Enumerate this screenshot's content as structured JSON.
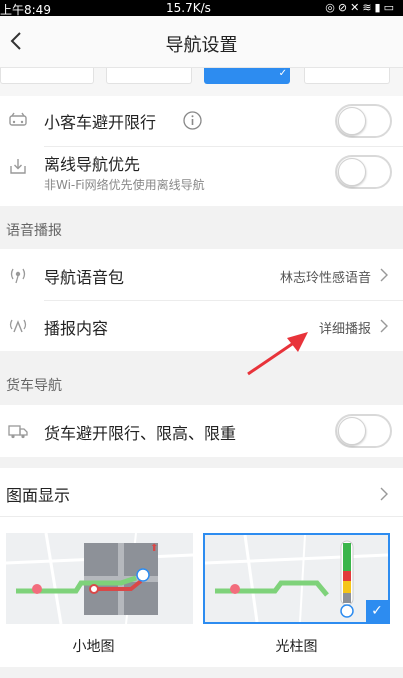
{
  "status_bar": {
    "time": "上午8:49",
    "speed": "15.7K/s"
  },
  "header": {
    "title": "导航设置"
  },
  "settings": {
    "avoid_limit_car": {
      "label": "小客车避开限行",
      "enabled": false
    },
    "offline_nav": {
      "label": "离线导航优先",
      "subtitle": "非Wi-Fi网络优先使用离线导航",
      "enabled": false
    }
  },
  "voice_section": {
    "heading": "语音播报",
    "voice_pack": {
      "label": "导航语音包",
      "value": "林志玲性感语音"
    },
    "broadcast": {
      "label": "播报内容",
      "value": "详细播报"
    }
  },
  "truck_section": {
    "heading": "货车导航",
    "truck_avoid": {
      "label": "货车避开限行、限高、限重",
      "enabled": false
    }
  },
  "display_section": {
    "heading": "图面显示",
    "options": [
      {
        "label": "小地图",
        "selected": false
      },
      {
        "label": "光柱图",
        "selected": true
      }
    ]
  },
  "colors": {
    "accent": "#2d8cf0",
    "arrow": "#e8333a"
  }
}
